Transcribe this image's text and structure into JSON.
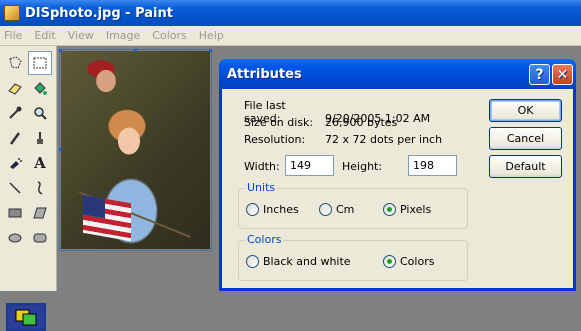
{
  "window": {
    "title": "DISphoto.jpg - Paint",
    "icon": "paint-app-icon"
  },
  "menu": [
    "File",
    "Edit",
    "View",
    "Image",
    "Colors",
    "Help"
  ],
  "toolbox": {
    "tools": [
      "free-form-select-icon",
      "rect-select-icon",
      "eraser-icon",
      "fill-icon",
      "color-picker-icon",
      "magnifier-icon",
      "pencil-icon",
      "brush-icon",
      "airbrush-icon",
      "text-icon",
      "line-icon",
      "curve-icon",
      "rectangle-icon",
      "polygon-icon",
      "ellipse-icon",
      "rounded-rect-icon"
    ],
    "selected": "rect-select-icon"
  },
  "canvas": {
    "image_name": "DISphoto.jpg"
  },
  "dialog": {
    "title": "Attributes",
    "help_glyph": "?",
    "close_glyph": "✕",
    "info": [
      {
        "label": "File last saved:",
        "value": "9/20/2005 1:02 AM"
      },
      {
        "label": "Size on disk:",
        "value": "26,900 bytes"
      },
      {
        "label": "Resolution:",
        "value": "72 x 72 dots per inch"
      }
    ],
    "width_label": "Width:",
    "width_value": "149",
    "height_label": "Height:",
    "height_value": "198",
    "units": {
      "title": "Units",
      "options": [
        "Inches",
        "Cm",
        "Pixels"
      ],
      "selected": "Pixels"
    },
    "colors": {
      "title": "Colors",
      "options": [
        "Black and white",
        "Colors"
      ],
      "selected": "Colors"
    },
    "buttons": {
      "ok": "OK",
      "cancel": "Cancel",
      "default": "Default"
    }
  }
}
